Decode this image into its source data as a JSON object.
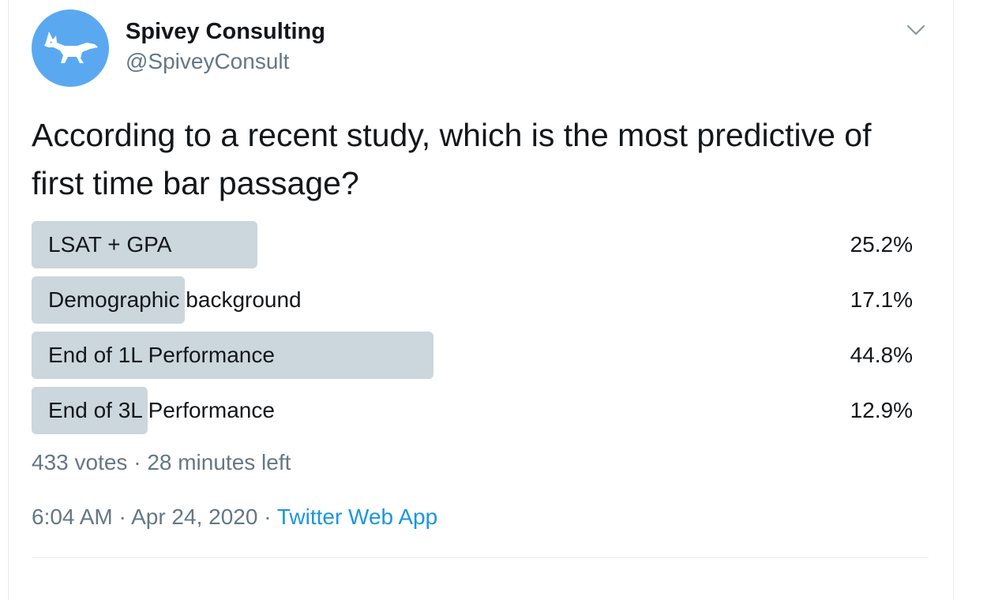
{
  "tweet": {
    "author": {
      "display_name": "Spivey Consulting",
      "handle": "@SpiveyConsult",
      "avatar_icon": "fox-logo-icon",
      "avatar_color": "#5aa9f0"
    },
    "more_menu_icon": "chevron-down-icon",
    "text": "According to a recent study, which is the most predictive of first time bar passage?",
    "poll": {
      "options": [
        {
          "label": "LSAT + GPA",
          "percent_text": "25.2%",
          "percent": 25.2
        },
        {
          "label": "Demographic background",
          "percent_text": "17.1%",
          "percent": 17.1
        },
        {
          "label": "End of 1L Performance",
          "percent_text": "44.8%",
          "percent": 44.8
        },
        {
          "label": "End of 3L Performance",
          "percent_text": "12.9%",
          "percent": 12.9
        }
      ],
      "votes": "433 votes",
      "separator": "·",
      "time_left": "28 minutes left",
      "bar_color": "#ccd6dd"
    },
    "time": "6:04 AM",
    "date": "Apr 24, 2020",
    "source": "Twitter Web App",
    "link_color": "#1b95e0"
  }
}
